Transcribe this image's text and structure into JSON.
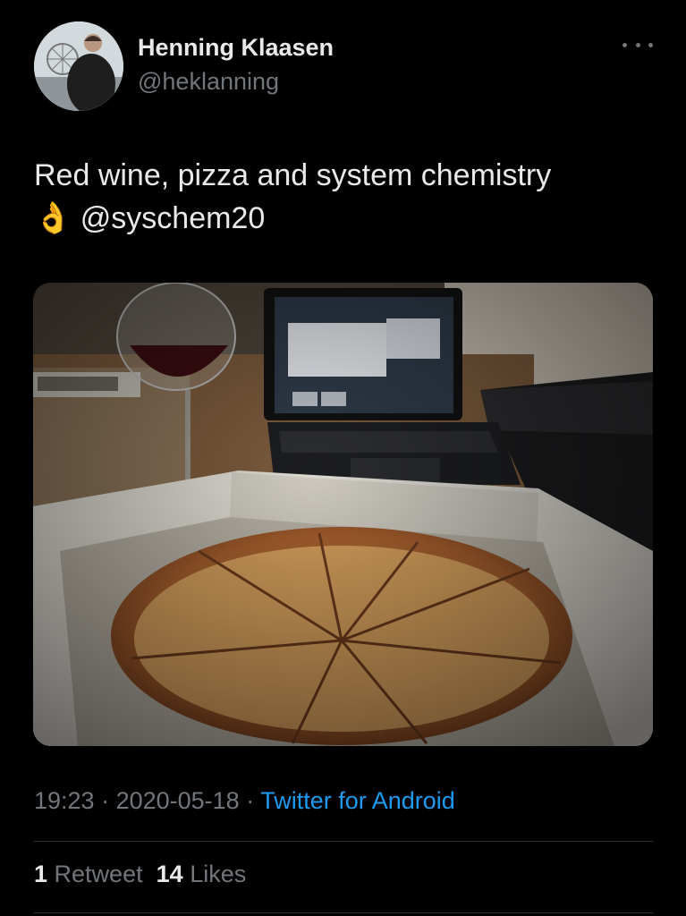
{
  "author": {
    "name": "Henning Klaasen",
    "handle": "@heklanning"
  },
  "tweet": {
    "text_line1": "Red wine, pizza and system chemistry",
    "emoji": "👌",
    "mention": "@syschem20"
  },
  "meta": {
    "time": "19:23",
    "sep1": " · ",
    "date": "2020-05-18",
    "sep2": " · ",
    "source": "Twitter for Android"
  },
  "stats": {
    "retweets_count": "1",
    "retweets_label": "Retweet",
    "likes_count": "14",
    "likes_label": "Likes"
  },
  "icons": {
    "more": "more-horizontal-icon"
  },
  "colors": {
    "background": "#000000",
    "text": "#e7e9ea",
    "muted": "#71767b",
    "link": "#1d9bf0"
  }
}
